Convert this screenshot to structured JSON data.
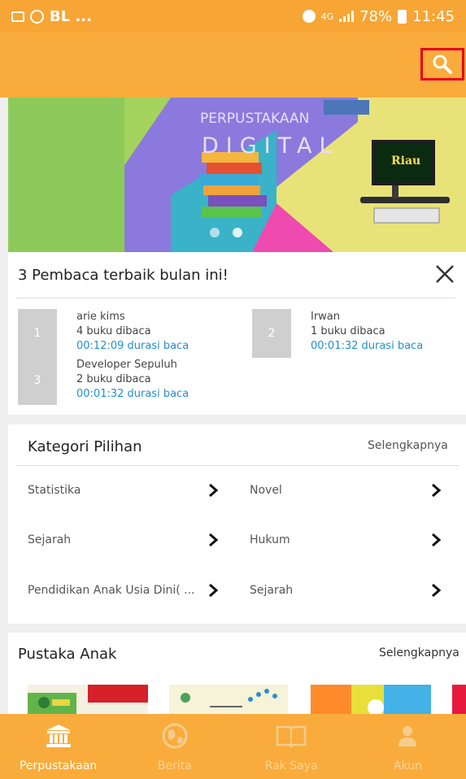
{
  "status_bar": {
    "carrier": "BL ...",
    "network": "4G",
    "battery": "78%",
    "time": "11:45"
  },
  "banner": {
    "title": "PERPUSTAKAAN",
    "subtitle": "DIGITAL",
    "badge_text": "Riau"
  },
  "top_readers": {
    "title": "3 Pembaca terbaik bulan ini!",
    "readers": [
      {
        "rank": "1",
        "name": "arie kims",
        "books": "4 buku dibaca",
        "duration": "00:12:09 durasi baca"
      },
      {
        "rank": "2",
        "name": "Irwan",
        "books": "1 buku dibaca",
        "duration": "00:01:32 durasi baca"
      },
      {
        "rank": "3",
        "name": "Developer Sepuluh",
        "books": "2 buku dibaca",
        "duration": "00:01:32 durasi baca"
      }
    ]
  },
  "categories": {
    "title": "Kategori Pilihan",
    "more_label": "Selengkapnya",
    "items": [
      "Statistika",
      "Novel",
      "Sejarah",
      "Hukum",
      "Pendidikan Anak Usia Dini( ...",
      "Sejarah"
    ]
  },
  "children_books": {
    "title": "Pustaka Anak",
    "more_label": "Selengkapnya"
  },
  "bottom_nav": [
    {
      "label": "Perpustakaan",
      "icon": "library-icon",
      "active": true
    },
    {
      "label": "Berita",
      "icon": "globe-icon",
      "active": false
    },
    {
      "label": "Rak Saya",
      "icon": "book-open-icon",
      "active": false
    },
    {
      "label": "Akun",
      "icon": "person-icon",
      "active": false
    }
  ],
  "colors": {
    "primary": "#f9ac3c",
    "status_bar": "#f7a535",
    "link_blue": "#1f8fd2",
    "search_highlight": "#e8001f"
  }
}
